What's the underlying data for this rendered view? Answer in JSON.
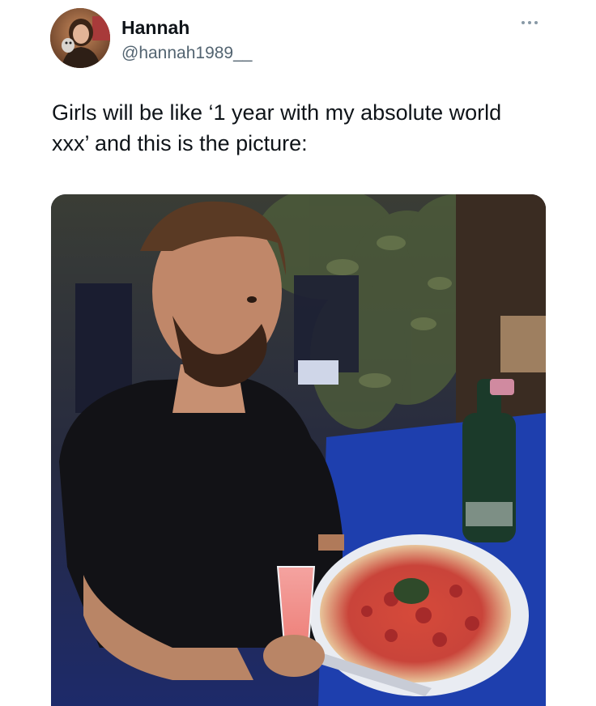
{
  "tweet": {
    "author": {
      "display_name": "Hannah",
      "handle": "@hannah1989__",
      "avatar_icon": "profile-photo"
    },
    "more_icon": "more-horizontal-icon",
    "text": "Girls will be like ‘1 year with my absolute world\nxxx’ and this is the picture:",
    "media": {
      "type": "photo",
      "description_icon": "photo-man-with-pizza"
    }
  },
  "colors": {
    "text_primary": "#0f1419",
    "text_secondary": "#536471"
  }
}
